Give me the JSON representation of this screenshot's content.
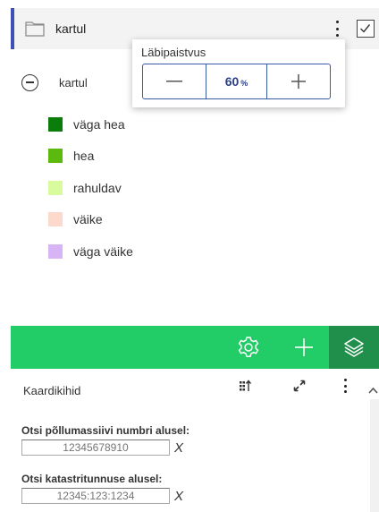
{
  "layer": {
    "title": "kartul",
    "checked": true
  },
  "opacity_popup": {
    "label": "Läbipaistvus",
    "value": "60",
    "unit": "%",
    "decrease_symbol": "—",
    "increase_symbol": "+"
  },
  "legend": {
    "title": "kartul",
    "items": [
      {
        "label": "väga hea",
        "color": "#0a7d0a"
      },
      {
        "label": "hea",
        "color": "#5cb90e"
      },
      {
        "label": "rahuldav",
        "color": "#d8fb9e"
      },
      {
        "label": "väike",
        "color": "#fbd9cc"
      },
      {
        "label": "väga väike",
        "color": "#d7b5f5"
      }
    ]
  },
  "toolbar": {
    "background": "#22cc66",
    "active_background": "#1f8f4b",
    "icons": [
      "gear-icon",
      "plus-icon",
      "layers-icon"
    ]
  },
  "panel": {
    "title": "Kaardikihid",
    "icons": [
      "sort-icon",
      "expand-icon",
      "more-vertical-icon"
    ]
  },
  "search": {
    "parcel_label": "Otsi põllumassiivi numbri alusel:",
    "parcel_placeholder": "12345678910",
    "cadastre_label": "Otsi katastritunnuse alusel:",
    "cadastre_placeholder": "12345:123:1234",
    "clear_symbol": "X"
  }
}
